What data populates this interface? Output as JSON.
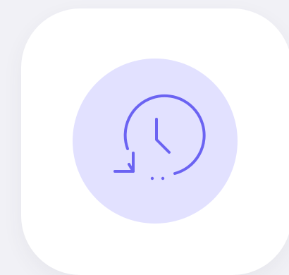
{
  "app_icon": {
    "icon_name": "history-icon",
    "colors": {
      "page_background": "#f1f1f6",
      "tile_background": "#ffffff",
      "circle_background": "#e2e1ff",
      "icon_stroke": "#6b63f2"
    }
  }
}
